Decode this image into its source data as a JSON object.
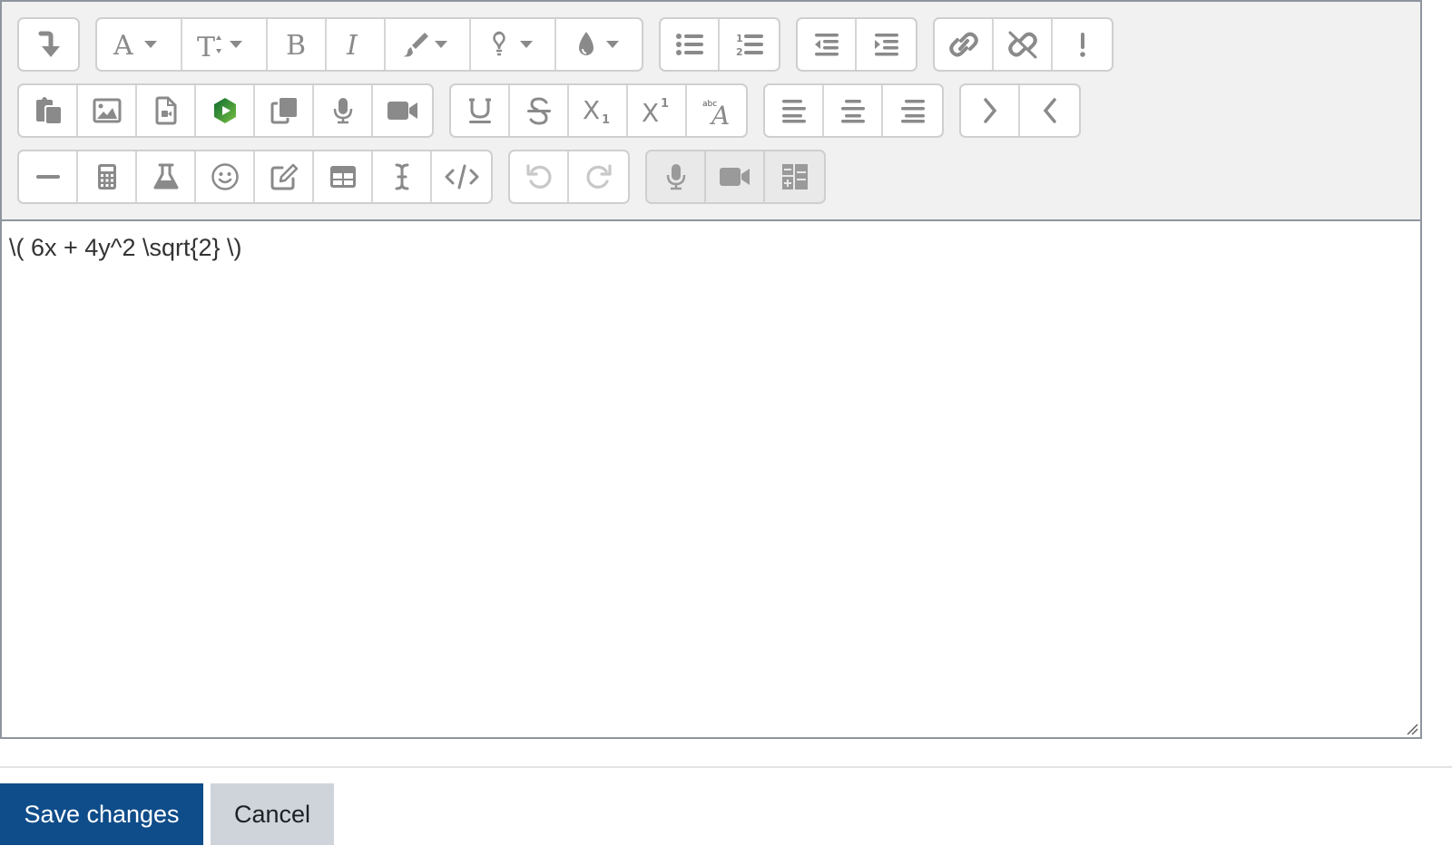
{
  "toolbar": {
    "colors": {
      "icon": "#8a8a8a",
      "icon_disabled": "#c8c8c8",
      "panopto_green_dark": "#0b6b2e",
      "panopto_green_light": "#5cb85c"
    },
    "row1": [
      {
        "group": "collapse",
        "buttons": [
          {
            "name": "toolbar-toggle",
            "icon": "arrow-turn-down-icon",
            "title": "Show more buttons"
          }
        ]
      },
      {
        "group": "style",
        "buttons": [
          {
            "name": "font-family",
            "icon": "font-icon",
            "dropdown": true
          },
          {
            "name": "font-size",
            "icon": "text-height-icon",
            "dropdown": true
          },
          {
            "name": "bold",
            "icon": "bold-icon"
          },
          {
            "name": "italic",
            "icon": "italic-icon"
          },
          {
            "name": "font-color",
            "icon": "paint-brush-icon",
            "dropdown": true
          },
          {
            "name": "background-color",
            "icon": "lightbulb-icon",
            "dropdown": true
          },
          {
            "name": "color-picker",
            "icon": "tint-icon",
            "dropdown": true
          }
        ]
      },
      {
        "group": "list",
        "buttons": [
          {
            "name": "unordered-list",
            "icon": "list-ul-icon"
          },
          {
            "name": "ordered-list",
            "icon": "list-ol-icon"
          }
        ]
      },
      {
        "group": "indent",
        "buttons": [
          {
            "name": "outdent",
            "icon": "outdent-icon"
          },
          {
            "name": "indent",
            "icon": "indent-icon"
          }
        ]
      },
      {
        "group": "links",
        "buttons": [
          {
            "name": "link",
            "icon": "link-icon"
          },
          {
            "name": "unlink",
            "icon": "unlink-icon"
          },
          {
            "name": "accessibility-checker",
            "icon": "exclamation-icon"
          }
        ]
      }
    ],
    "row2": [
      {
        "group": "files",
        "buttons": [
          {
            "name": "paste",
            "icon": "paste-icon"
          },
          {
            "name": "image",
            "icon": "image-icon"
          },
          {
            "name": "media",
            "icon": "file-video-icon"
          },
          {
            "name": "panopto",
            "icon": "panopto-icon"
          },
          {
            "name": "copy",
            "icon": "copy-icon"
          },
          {
            "name": "record-audio",
            "icon": "microphone-icon"
          },
          {
            "name": "record-video",
            "icon": "video-camera-icon"
          }
        ]
      },
      {
        "group": "style2",
        "buttons": [
          {
            "name": "underline",
            "icon": "underline-icon"
          },
          {
            "name": "strikethrough",
            "icon": "strikethrough-icon"
          },
          {
            "name": "subscript",
            "icon": "subscript-icon"
          },
          {
            "name": "superscript",
            "icon": "superscript-icon"
          },
          {
            "name": "clear-formatting",
            "icon": "clear-format-icon"
          }
        ]
      },
      {
        "group": "align",
        "buttons": [
          {
            "name": "align-left",
            "icon": "align-left-icon"
          },
          {
            "name": "align-center",
            "icon": "align-center-icon"
          },
          {
            "name": "align-right",
            "icon": "align-right-icon"
          }
        ]
      },
      {
        "group": "direction",
        "buttons": [
          {
            "name": "ltr",
            "icon": "chevron-right-icon"
          },
          {
            "name": "rtl",
            "icon": "chevron-left-icon"
          }
        ]
      }
    ],
    "row3": [
      {
        "group": "insert",
        "buttons": [
          {
            "name": "horizontal-rule",
            "icon": "minus-icon"
          },
          {
            "name": "equation",
            "icon": "calculator-icon"
          },
          {
            "name": "chemistry",
            "icon": "flask-icon"
          },
          {
            "name": "emoticon",
            "icon": "smile-icon"
          },
          {
            "name": "manage-files",
            "icon": "edit-icon"
          },
          {
            "name": "table",
            "icon": "table-icon"
          },
          {
            "name": "special-character",
            "icon": "i-cursor-icon"
          },
          {
            "name": "html",
            "icon": "code-icon"
          }
        ]
      },
      {
        "group": "undo",
        "buttons": [
          {
            "name": "undo",
            "icon": "undo-icon",
            "disabled": true
          },
          {
            "name": "redo",
            "icon": "redo-icon",
            "disabled": true
          }
        ]
      },
      {
        "group": "other",
        "disabled": true,
        "buttons": [
          {
            "name": "record-audio-2",
            "icon": "microphone-icon"
          },
          {
            "name": "record-video-2",
            "icon": "video-camera-icon"
          },
          {
            "name": "wiris-editor",
            "icon": "math-formula-icon"
          }
        ]
      }
    ]
  },
  "editor": {
    "content": "\\( 6x + 4y^2 \\sqrt{2} \\)"
  },
  "actions": {
    "save_label": "Save changes",
    "cancel_label": "Cancel",
    "save_color": "#0f4c8a",
    "cancel_color": "#ced4da"
  }
}
